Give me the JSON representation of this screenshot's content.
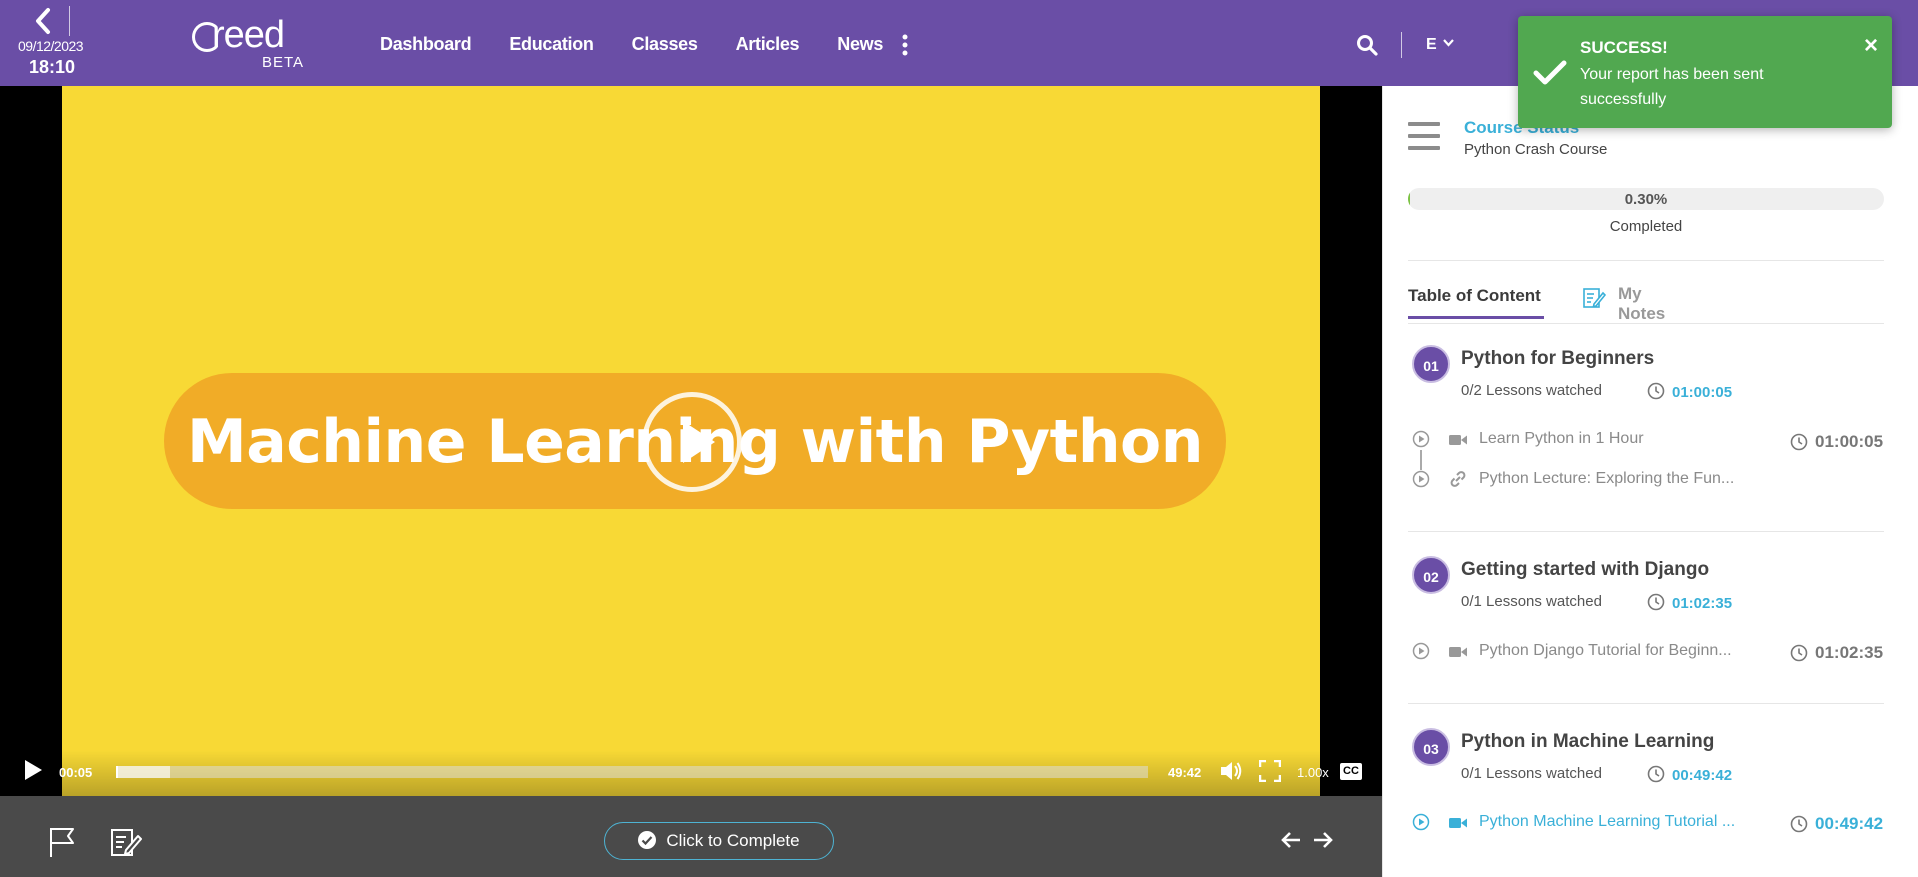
{
  "header": {
    "date": "09/12/2023",
    "time": "18:10",
    "logo_text": "reed",
    "logo_badge": "BETA",
    "nav": [
      "Dashboard",
      "Education",
      "Classes",
      "Articles",
      "News"
    ],
    "language": "E"
  },
  "video": {
    "title_text": "Machine Learning with Python",
    "current_time": "00:05",
    "duration": "49:42",
    "speed": "1.00x",
    "cc_label": "CC",
    "played_fraction": 0.0017,
    "colors": {
      "background": "#f8d935",
      "pill": "#f1ac27"
    }
  },
  "footer": {
    "complete_label": "Click to Complete"
  },
  "sidebar": {
    "status_title": "Course Status",
    "course_name": "Python Crash Course",
    "progress_text": "0.30%",
    "progress_percent": 0.3,
    "progress_label": "Completed",
    "tabs": {
      "toc": "Table of Content",
      "notes": "My Notes"
    },
    "sections": [
      {
        "number": "01",
        "title": "Python for Beginners",
        "watched": "0/2 Lessons watched",
        "duration": "01:00:05",
        "lessons": [
          {
            "title": "Learn Python in 1 Hour",
            "type": "video-icon",
            "duration": "01:00:05"
          },
          {
            "title": "Python Lecture: Exploring the Fun...",
            "type": "link-icon",
            "duration": ""
          }
        ]
      },
      {
        "number": "02",
        "title": "Getting started with Django",
        "watched": "0/1 Lessons watched",
        "duration": "01:02:35",
        "lessons": [
          {
            "title": "Python Django Tutorial for Beginn...",
            "type": "video-icon",
            "duration": "01:02:35"
          }
        ]
      },
      {
        "number": "03",
        "title": "Python in Machine Learning",
        "watched": "0/1 Lessons watched",
        "duration": "00:49:42",
        "lessons": [
          {
            "title": "Python Machine Learning Tutorial ...",
            "type": "video-icon",
            "duration": "00:49:42",
            "active": true
          }
        ]
      }
    ]
  },
  "toast": {
    "title": "SUCCESS!",
    "message": "Your report has been sent successfully",
    "close": "×"
  },
  "colors": {
    "brand_purple": "#6a4ea6",
    "accent_blue": "#3ab0d8",
    "success_green": "#51a850",
    "progress_green": "#7cc243"
  }
}
